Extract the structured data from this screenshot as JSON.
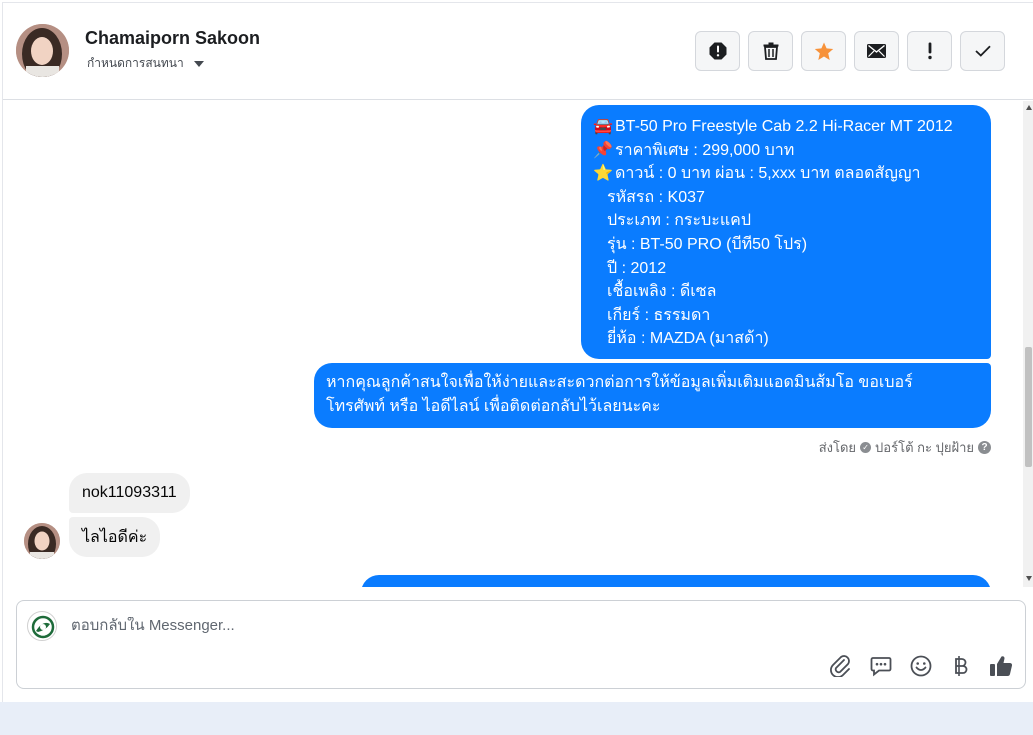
{
  "header": {
    "contact_name": "Chamaiporn Sakoon",
    "assign_label": "กำหนดการสนทนา",
    "actions": [
      {
        "name": "mark-spam-button",
        "icon": "alert-octagon-icon"
      },
      {
        "name": "delete-button",
        "icon": "trash-icon"
      },
      {
        "name": "star-button",
        "icon": "star-icon"
      },
      {
        "name": "mark-unread-button",
        "icon": "envelope-icon"
      },
      {
        "name": "follow-up-button",
        "icon": "exclamation-icon"
      },
      {
        "name": "mark-done-button",
        "icon": "checkmark-icon"
      }
    ]
  },
  "messages": {
    "listing": {
      "lines": [
        {
          "icon": "🚘",
          "text": "BT-50 Pro Freestyle Cab 2.2 Hi-Racer MT 2012"
        },
        {
          "icon": "📌",
          "text": "ราคาพิเศษ : 299,000 บาท"
        },
        {
          "icon": "⭐",
          "text": "ดาวน์ : 0 บาท ผ่อน : 5,xxx บาท ตลอดสัญญา"
        },
        {
          "icon": "",
          "text": "รหัสรถ : K037"
        },
        {
          "icon": "",
          "text": "ประเภท : กระบะแคป"
        },
        {
          "icon": "",
          "text": "รุ่น : BT-50 PRO (บีที50 โปร)"
        },
        {
          "icon": "",
          "text": "ปี : 2012"
        },
        {
          "icon": "",
          "text": "เชื้อเพลิง : ดีเซล"
        },
        {
          "icon": "",
          "text": "เกียร์ : ธรรมดา"
        },
        {
          "icon": "",
          "text": "ยี่ห้อ : MAZDA (มาสด้า)"
        }
      ]
    },
    "contact_request": {
      "line1": "หากคุณลูกค้าสนใจเพื่อให้ง่ายและสะดวกต่อการให้ข้อมูลเพิ่มเติมแอดมินส้มโอ ขอเบอร์",
      "line2": "โทรศัพท์ หรือ ไอดีไลน์ เพื่อติดต่อกลับไว้เลยนะคะ"
    },
    "sent_by_label": "ส่งโดย",
    "sent_by_name": "ปอร์โต้ กะ ปุยฝ้าย",
    "incoming_1": "nok11093311",
    "incoming_2": "ไลไอดีค่ะ"
  },
  "composer": {
    "placeholder": "ตอบกลับใน Messenger...",
    "tools": [
      "paperclip-icon",
      "saved-reply-icon",
      "emoji-icon",
      "baht-icon",
      "thumbs-up-icon"
    ]
  },
  "colors": {
    "outgoing_bubble": "#0a7cff",
    "incoming_bubble": "#f0f0f0",
    "star": "#f7923a"
  }
}
